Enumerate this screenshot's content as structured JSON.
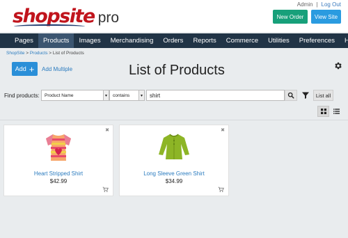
{
  "brand": {
    "name": "shopsite",
    "suffix": "pro"
  },
  "top_links": {
    "admin": "Admin",
    "separator": "|",
    "logout": "Log Out"
  },
  "header_buttons": {
    "new_order": "New Order",
    "view_site": "View Site"
  },
  "nav": {
    "items": [
      {
        "label": "Pages"
      },
      {
        "label": "Products",
        "active": true
      },
      {
        "label": "Images"
      },
      {
        "label": "Merchandising"
      },
      {
        "label": "Orders"
      },
      {
        "label": "Reports"
      },
      {
        "label": "Commerce"
      },
      {
        "label": "Utilities"
      },
      {
        "label": "Preferences"
      },
      {
        "label": "Help"
      }
    ]
  },
  "breadcrumb": {
    "root": "ShopSite",
    "sep": " > ",
    "section": "Products",
    "current": "List of Products"
  },
  "actions": {
    "add": "Add",
    "add_multiple": "Add Multiple"
  },
  "page_title": "List of Products",
  "filter": {
    "label": "Find products:",
    "field": "Product Name",
    "operator": "contains",
    "query": "shirt",
    "list_all": "List all"
  },
  "products": [
    {
      "name": "Heart Stripped Shirt",
      "price": "$42.99"
    },
    {
      "name": "Long Sleeve Green Shirt",
      "price": "$34.99"
    }
  ],
  "colors": {
    "brand_red": "#c0141c",
    "nav_bg": "#213446",
    "accent_blue": "#2a8fd8",
    "green_button": "#17a07a"
  }
}
